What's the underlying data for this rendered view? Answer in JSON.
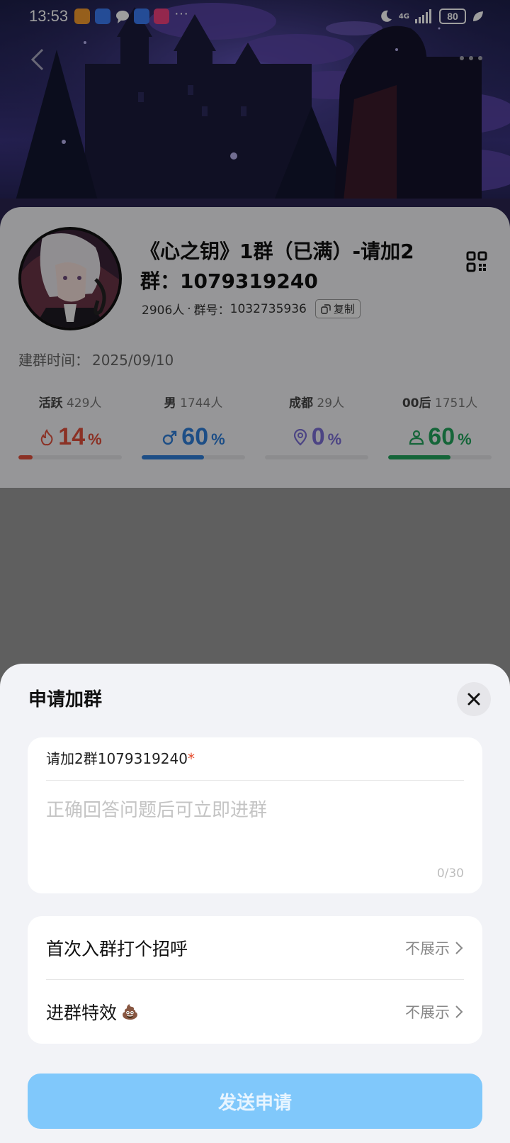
{
  "status_bar": {
    "time": "13:53",
    "network": "4G",
    "battery": "80",
    "more": "···"
  },
  "group": {
    "name": "《心之钥》1群（已满）-请加2群：1079319240",
    "members": "2906人",
    "separator": "·",
    "id_label": "群号：",
    "id": "1032735936",
    "copy_label": "复制",
    "created_label": "建群时间：",
    "created_date": "2025/09/10"
  },
  "stats": [
    {
      "key": "活跃",
      "detail": "429人",
      "value": "14",
      "unit": "%",
      "percent": 14,
      "color": "#e0503d",
      "icon": "flame-icon"
    },
    {
      "key": "男",
      "detail": "1744人",
      "value": "60",
      "unit": "%",
      "percent": 60,
      "color": "#2f7ed8",
      "icon": "male-icon"
    },
    {
      "key": "成都",
      "detail": "29人",
      "value": "0",
      "unit": "%",
      "percent": 0,
      "color": "#7b6fd6",
      "icon": "location-pin-icon"
    },
    {
      "key": "00后",
      "detail": "1751人",
      "value": "60",
      "unit": "%",
      "percent": 60,
      "color": "#22a45d",
      "icon": "person-icon"
    }
  ],
  "sheet": {
    "title": "申请加群",
    "question": "请加2群1079319240",
    "required_mark": "*",
    "answer_placeholder": "正确回答问题后可立即进群",
    "counter": "0/30",
    "greeting_label": "首次入群打个招呼",
    "greeting_value": "不展示",
    "effect_label": "进群特效",
    "effect_emoji": "💩",
    "effect_value": "不展示",
    "submit_label": "发送申请"
  }
}
